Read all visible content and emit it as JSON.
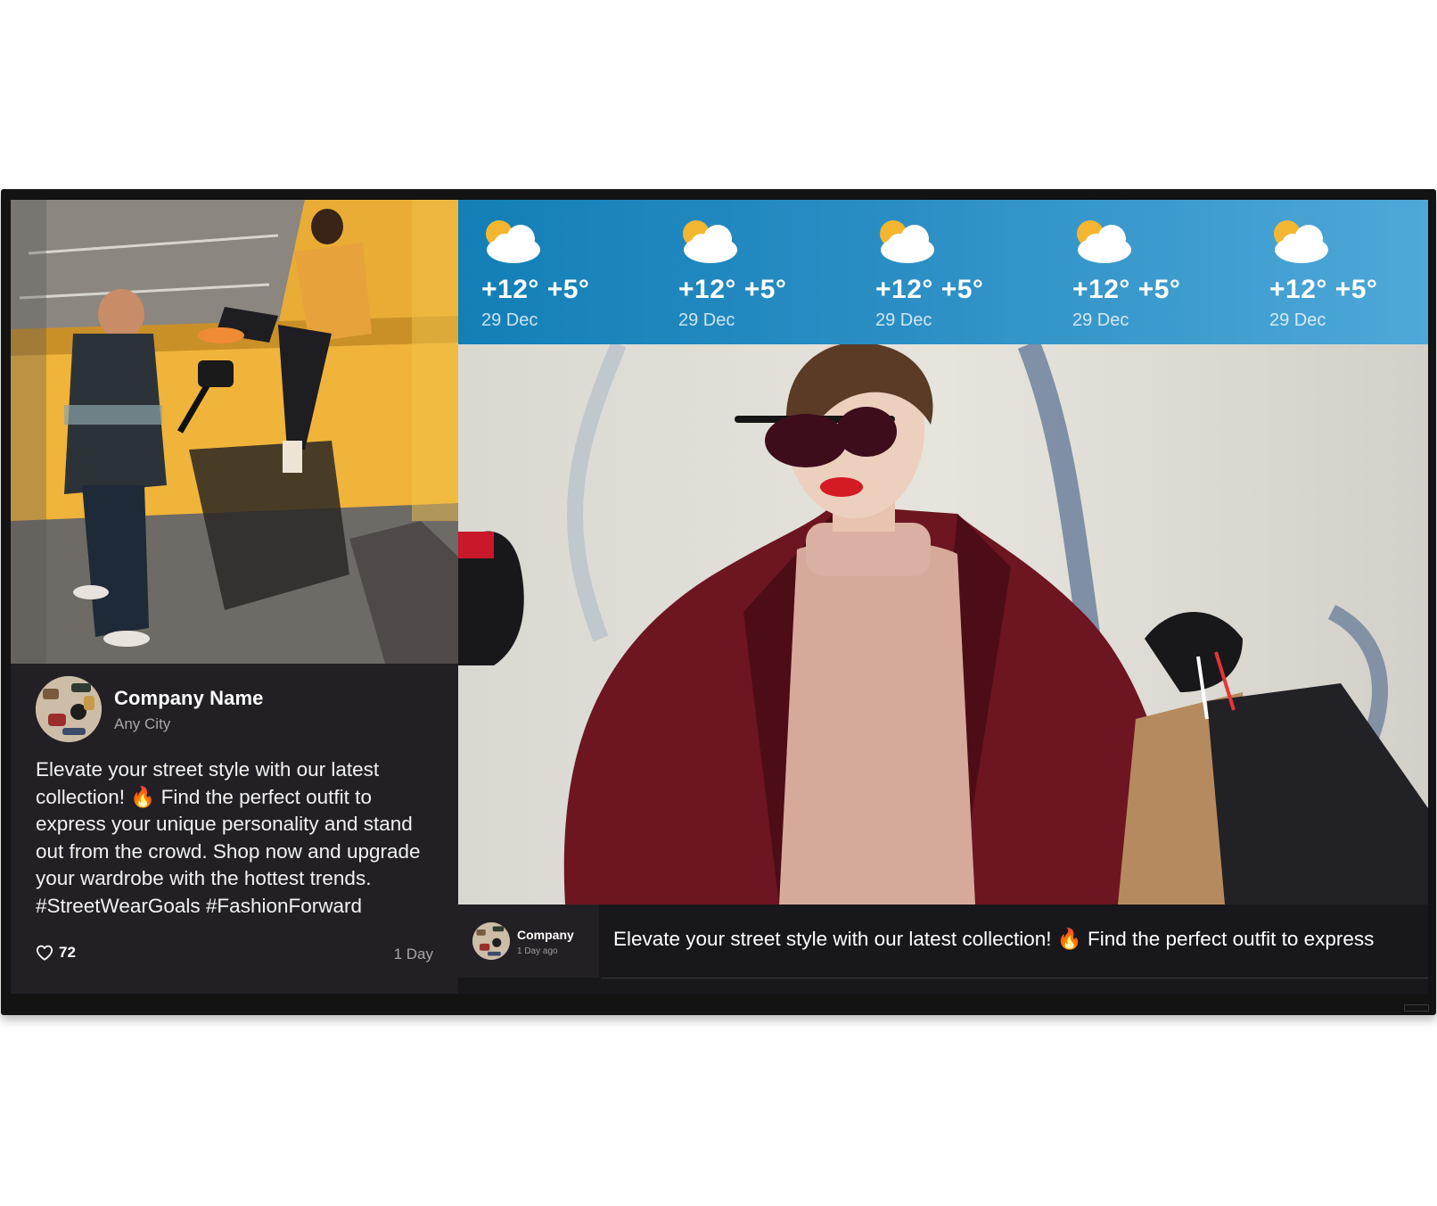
{
  "post": {
    "company_name": "Company Name",
    "city": "Any City",
    "text": "Elevate your street style with our latest collection! 🔥 Find the perfect outfit to express your unique personality and stand out from the crowd. Shop now and upgrade your wardrobe with the hottest trends. #StreetWearGoals #FashionForward",
    "likes": "72",
    "age": "1 Day"
  },
  "weather": {
    "icon": "partly-cloudy-icon",
    "days": [
      {
        "temp": "+12° +5°",
        "date": "29 Dec"
      },
      {
        "temp": "+12° +5°",
        "date": "29 Dec"
      },
      {
        "temp": "+12° +5°",
        "date": "29 Dec"
      },
      {
        "temp": "+12° +5°",
        "date": "29 Dec"
      },
      {
        "temp": "+12° +5°",
        "date": "29 Dec"
      }
    ]
  },
  "ticker": {
    "company": "Company",
    "age": "1 Day ago",
    "text": "Elevate your street style with our latest collection! 🔥 Find the perfect outfit to express"
  },
  "colors": {
    "weather_bg": "#137fb7",
    "panel_bg": "#222024",
    "ticker_bg": "#18171b"
  }
}
